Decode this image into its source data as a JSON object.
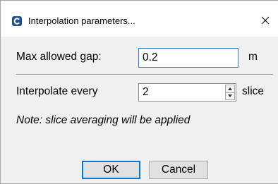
{
  "window": {
    "title": "Interpolation parameters...",
    "close_glyph": "✕",
    "app_icon": "app-logo-icon",
    "accent_color": "#0078d7"
  },
  "form": {
    "max_gap_label": "Max allowed gap:",
    "max_gap_value": "0.2",
    "max_gap_unit": "m",
    "interpolate_label": "Interpolate every",
    "interpolate_value": "2",
    "interpolate_unit": "slice",
    "note": "Note: slice averaging will be applied"
  },
  "buttons": {
    "ok_label": "OK",
    "cancel_label": "Cancel"
  }
}
